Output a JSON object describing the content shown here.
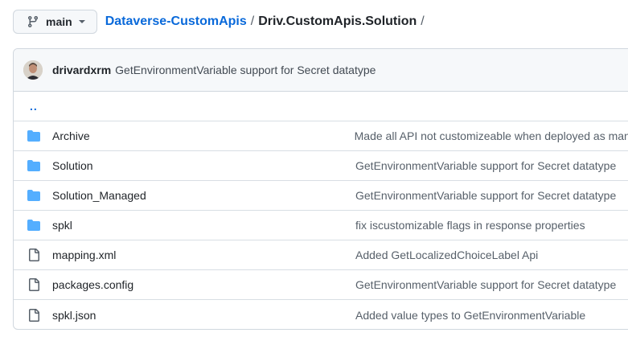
{
  "branch": {
    "name": "main",
    "icon": "git-branch-icon"
  },
  "breadcrumb": {
    "repo": "Dataverse-CustomApis",
    "sep1": "/",
    "folder": "Driv.CustomApis.Solution",
    "sep2": "/"
  },
  "commit": {
    "author": "drivardxrm",
    "message": "GetEnvironmentVariable support for Secret datatype"
  },
  "parent_link": "..",
  "colors": {
    "link": "#0969da",
    "folder": "#54aeff",
    "file": "#57606a"
  },
  "files": [
    {
      "type": "folder",
      "name": "Archive",
      "message": "Made all API not customizeable when deployed as managed"
    },
    {
      "type": "folder",
      "name": "Solution",
      "message": "GetEnvironmentVariable support for Secret datatype"
    },
    {
      "type": "folder",
      "name": "Solution_Managed",
      "message": "GetEnvironmentVariable support for Secret datatype"
    },
    {
      "type": "folder",
      "name": "spkl",
      "message": "fix iscustomizable flags in response properties"
    },
    {
      "type": "file",
      "name": "mapping.xml",
      "message": "Added GetLocalizedChoiceLabel Api"
    },
    {
      "type": "file",
      "name": "packages.config",
      "message": "GetEnvironmentVariable support for Secret datatype"
    },
    {
      "type": "file",
      "name": "spkl.json",
      "message": "Added value types to GetEnvironmentVariable"
    }
  ]
}
